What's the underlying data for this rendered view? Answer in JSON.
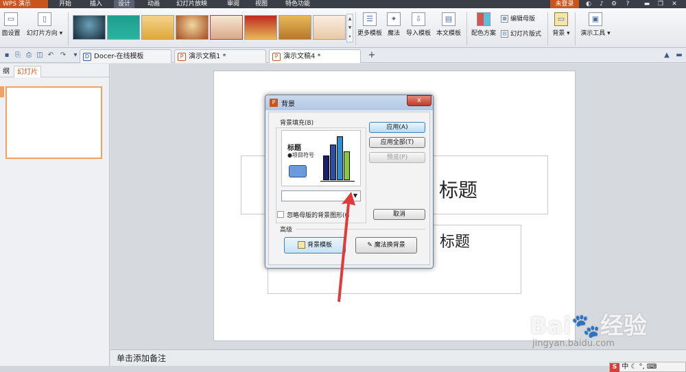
{
  "menubar": {
    "app": "WPS 演示",
    "items": [
      "开始",
      "插入",
      "设计",
      "动画",
      "幻灯片放映",
      "审阅",
      "视图",
      "特色功能"
    ],
    "active": "设计",
    "login": "未登录",
    "help": "?"
  },
  "ribbon": {
    "page_setup": "面设置",
    "slide_direction": "幻灯片方向",
    "more_templates": "更多模板",
    "magic": "魔法",
    "import_template": "导入模板",
    "this_template": "本文模板",
    "color_scheme": "配色方案",
    "edit_master": "编辑母版",
    "slide_layout": "幻灯片版式",
    "background": "背景",
    "presentation_tools": "演示工具"
  },
  "tabs": [
    {
      "label": "Docer-在线模板"
    },
    {
      "label": "演示文稿1 *"
    },
    {
      "label": "演示文稿4 *"
    }
  ],
  "new_tab": "+",
  "left_panel": {
    "tabs": [
      "纲",
      "幻灯片"
    ]
  },
  "slide": {
    "title_fragment": "标题",
    "subtitle_fragment": "标题"
  },
  "notes_placeholder": "单击添加备注",
  "dialog": {
    "title": "背景",
    "close": "x",
    "group_fill": "背景填充(B)",
    "preview_title": "标题",
    "preview_bullet": "●项目符号",
    "combo_arrow": "▼",
    "buttons": {
      "apply": "应用(A)",
      "apply_all": "应用全部(T)",
      "preview": "预览(P)",
      "cancel": "取消"
    },
    "ignore_master": "忽略母版的背景图形(G",
    "advanced": "高级",
    "bg_template": "背景模板",
    "magic_bg": "魔法换背景",
    "preview_colors": {
      "bar1": "#1a1f6b",
      "bar2": "#2a4fa0",
      "bar3": "#2f8ed0",
      "bar4": "#8bc63f",
      "shape": "#6a9bdc"
    }
  },
  "watermark": {
    "brand": "Bai",
    "brand_cn": "经验",
    "url": "jingyan.baidu.com"
  },
  "ime": {
    "label": "中"
  },
  "colors": {
    "accent": "#c8551c",
    "arrow": "#e03a3a"
  }
}
